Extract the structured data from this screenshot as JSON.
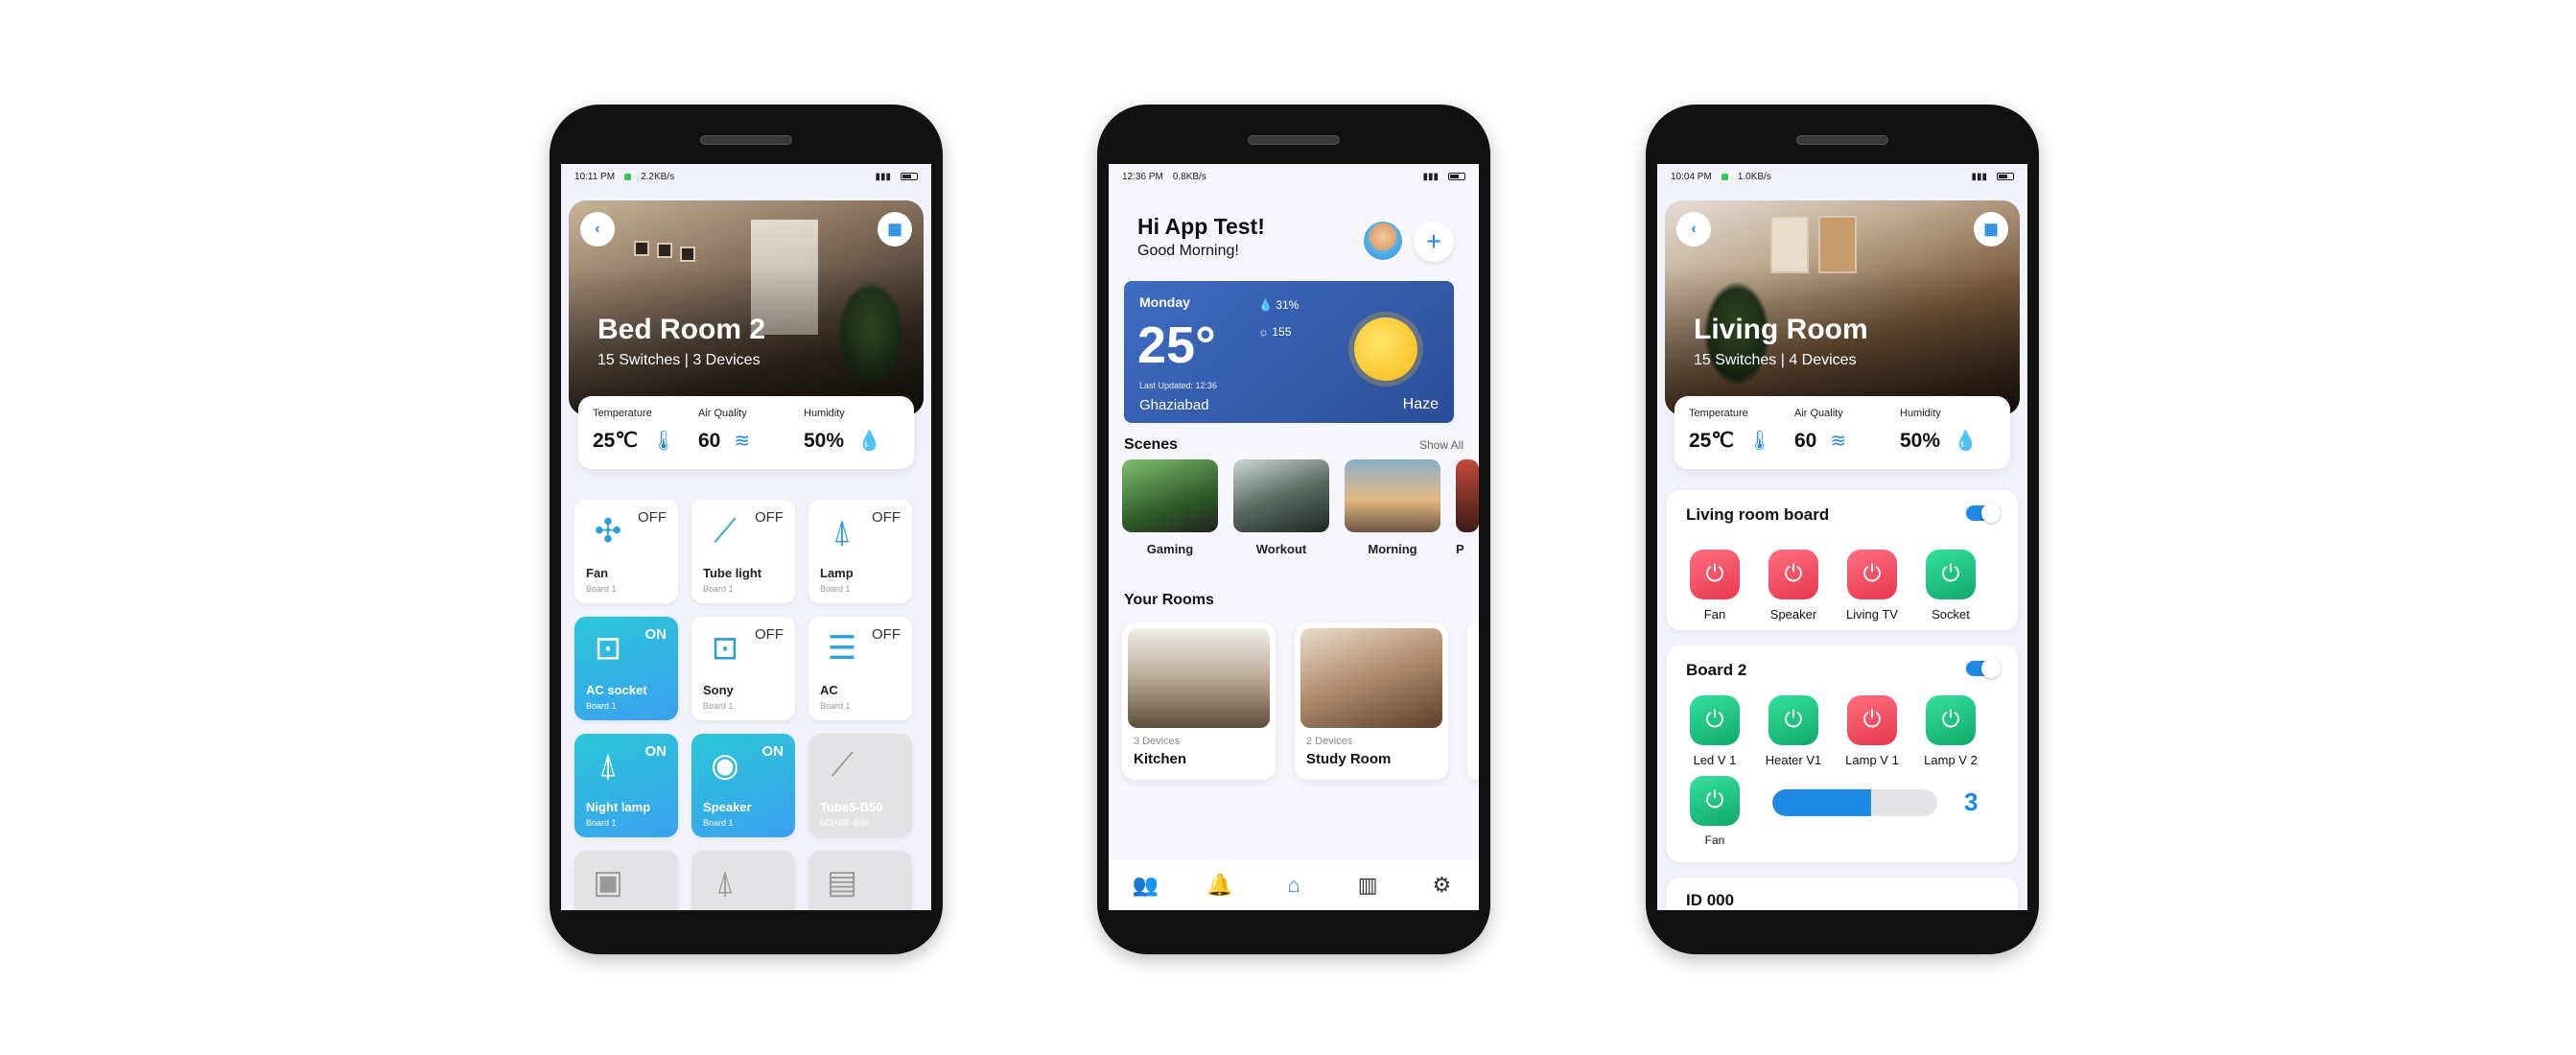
{
  "colors": {
    "accent": "#1e88e5",
    "tile_on": "#2bc7d8",
    "switch_red": "#e8384f",
    "switch_green": "#10a96a",
    "weather_card": "#3f6bc2"
  },
  "screen1": {
    "status": {
      "time": "10:11 PM",
      "speed": "2.2KB/s"
    },
    "hero": {
      "title": "Bed Room 2",
      "subtitle": "15 Switches | 3 Devices"
    },
    "sensors": [
      {
        "label": "Temperature",
        "value": "25℃",
        "icon": "thermometer-icon"
      },
      {
        "label": "Air Quality",
        "value": "60",
        "icon": "wind-icon"
      },
      {
        "label": "Humidity",
        "value": "50%",
        "icon": "droplet-icon"
      }
    ],
    "tiles": [
      {
        "name": "Fan",
        "sub": "Board 1",
        "state": "OFF",
        "icon": "fan-icon"
      },
      {
        "name": "Tube light",
        "sub": "Board 1",
        "state": "OFF",
        "icon": "tube-light-icon"
      },
      {
        "name": "Lamp",
        "sub": "Board 1",
        "state": "OFF",
        "icon": "lamp-icon"
      },
      {
        "name": "AC socket",
        "sub": "Board 1",
        "state": "ON",
        "icon": "socket-icon"
      },
      {
        "name": "Sony",
        "sub": "Board 1",
        "state": "OFF",
        "icon": "socket-icon"
      },
      {
        "name": "AC",
        "sub": "Board 1",
        "state": "OFF",
        "icon": "ac-icon"
      },
      {
        "name": "Night lamp",
        "sub": "Board 1",
        "state": "ON",
        "icon": "night-lamp-icon"
      },
      {
        "name": "Speaker",
        "sub": "Board 1",
        "state": "ON",
        "icon": "speaker-icon"
      },
      {
        "name": "Tube5-B50",
        "sub": "6CHWF-B50",
        "state": "",
        "icon": "tube-light-icon"
      },
      {
        "name": "",
        "sub": "",
        "state": "",
        "icon": "microwave-icon"
      },
      {
        "name": "",
        "sub": "",
        "state": "",
        "icon": "lamp-icon"
      },
      {
        "name": "",
        "sub": "",
        "state": "",
        "icon": "fridge-icon"
      }
    ]
  },
  "screen2": {
    "status": {
      "time": "12:36 PM",
      "speed": "0.8KB/s"
    },
    "greeting": "Hi App Test!",
    "subgreeting": "Good Morning!",
    "weather": {
      "day": "Monday",
      "temp": "25°",
      "humidity": "31%",
      "aqi": "155",
      "updated": "Last Updated: 12:36",
      "city": "Ghaziabad",
      "condition": "Haze"
    },
    "scenes_title": "Scenes",
    "show_all": "Show All",
    "scenes": [
      {
        "label": "Gaming"
      },
      {
        "label": "Workout"
      },
      {
        "label": "Morning"
      },
      {
        "label": "P"
      }
    ],
    "rooms_title": "Your Rooms",
    "rooms": [
      {
        "devices": "3 Devices",
        "name": "Kitchen"
      },
      {
        "devices": "2 Devices",
        "name": "Study Room"
      }
    ],
    "nav": [
      "users-icon",
      "bell-icon",
      "home-icon",
      "stats-icon",
      "gear-icon"
    ]
  },
  "screen3": {
    "status": {
      "time": "10:04 PM",
      "speed": "1.0KB/s"
    },
    "hero": {
      "title": "Living Room",
      "subtitle": "15 Switches | 4 Devices"
    },
    "sensors": [
      {
        "label": "Temperature",
        "value": "25℃",
        "icon": "thermometer-icon"
      },
      {
        "label": "Air Quality",
        "value": "60",
        "icon": "wind-icon"
      },
      {
        "label": "Humidity",
        "value": "50%",
        "icon": "droplet-icon"
      }
    ],
    "board1": {
      "title": "Living room board",
      "switches": [
        {
          "label": "Fan",
          "state": "red"
        },
        {
          "label": "Speaker",
          "state": "red"
        },
        {
          "label": "Living TV",
          "state": "red"
        },
        {
          "label": "Socket",
          "state": "green"
        }
      ]
    },
    "board2": {
      "title": "Board 2",
      "switches": [
        {
          "label": "Led V 1",
          "state": "green"
        },
        {
          "label": "Heater V1",
          "state": "green"
        },
        {
          "label": "Lamp V 1",
          "state": "red"
        },
        {
          "label": "Lamp V 2",
          "state": "green"
        },
        {
          "label": "Fan",
          "state": "green"
        }
      ],
      "fan_speed": "3",
      "fan_level": 0.6
    },
    "board3_title": "ID 000"
  }
}
